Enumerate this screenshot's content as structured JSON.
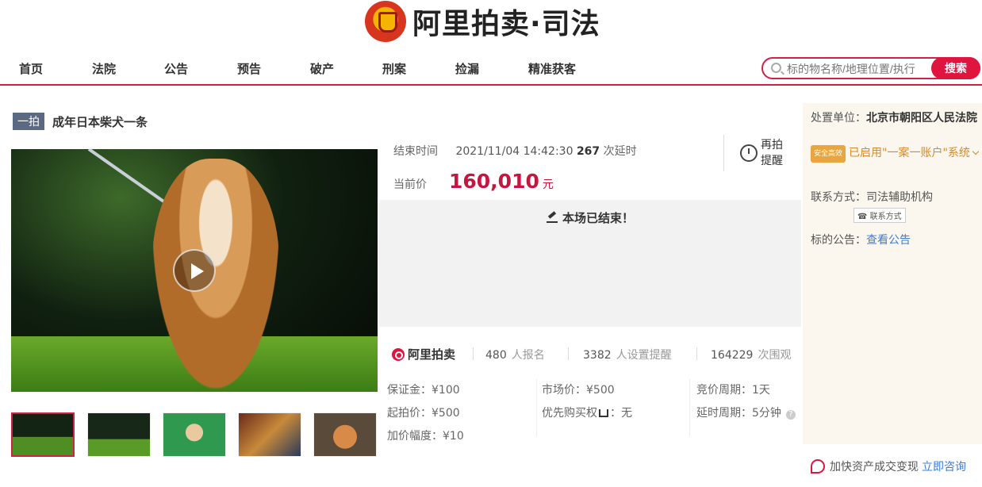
{
  "header": {
    "logo_text": "阿里拍卖·司法"
  },
  "nav": {
    "items": [
      "首页",
      "法院",
      "公告",
      "预告",
      "破产",
      "刑案",
      "捡漏",
      "精准获客"
    ],
    "search_placeholder": "标的物名称/地理位置/执行",
    "search_button": "搜索"
  },
  "item": {
    "badge": "一拍",
    "title": "成年日本柴犬一条"
  },
  "auction": {
    "end_label": "结束时间",
    "end_time": "2021/11/04 14:42:30",
    "delay_count": "267",
    "delay_suffix": "次延时",
    "price_label": "当前价",
    "price": "160,010",
    "price_unit": "元",
    "reauction_label": "再拍提醒",
    "status": "本场已结束！"
  },
  "stats": {
    "brand": "阿里拍卖",
    "signups": "480",
    "signups_label": "人报名",
    "reminders": "3382",
    "reminders_label": "人设置提醒",
    "views": "164229",
    "views_label": "次围观"
  },
  "details": {
    "deposit": "保证金：¥100",
    "start_price": "起拍价：¥500",
    "increment": "加价幅度：¥10",
    "market_price": "市场价：¥500",
    "priority_prefix": "优先购买权",
    "priority_value": "：无",
    "cycle": "竞价周期：1天",
    "delay_cycle": "延时周期：5分钟"
  },
  "side": {
    "court_label": "处置单位：",
    "court_name": "北京市朝阳区人民法院",
    "safe_badge": "安全高效",
    "security_text": "已启用\"一案一账户\"系统",
    "contact_label": "联系方式：",
    "contact_value": "司法辅助机构",
    "contact_button": "联系方式",
    "notice_label": "标的公告：",
    "notice_link": "查看公告"
  },
  "consult": {
    "text": "加快资产成交变现",
    "link": "立即咨询"
  },
  "colors": {
    "accent": "#d22147",
    "price": "#c4163e",
    "link": "#3b7dd8"
  }
}
